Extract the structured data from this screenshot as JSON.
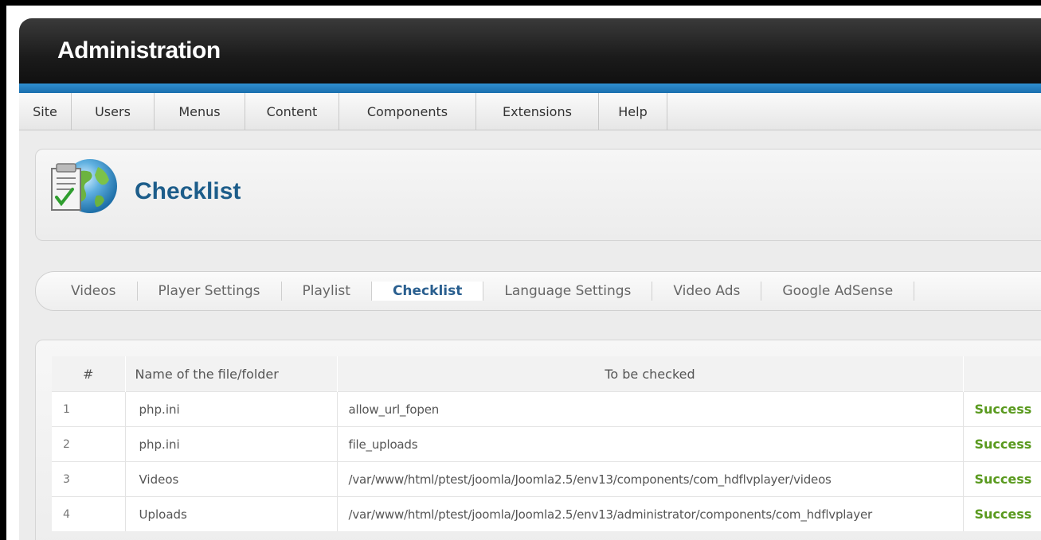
{
  "header": {
    "title": "Administration"
  },
  "menu": {
    "items": [
      {
        "label": "Site",
        "w": 66
      },
      {
        "label": "Users",
        "w": 104
      },
      {
        "label": "Menus",
        "w": 114
      },
      {
        "label": "Content",
        "w": 118
      },
      {
        "label": "Components",
        "w": 172
      },
      {
        "label": "Extensions",
        "w": 154
      },
      {
        "label": "Help",
        "w": 86
      }
    ]
  },
  "page": {
    "title": "Checklist",
    "icon": "checklist-globe-icon"
  },
  "tabs": {
    "items": [
      "Videos",
      "Player Settings",
      "Playlist",
      "Checklist",
      "Language Settings",
      "Video Ads",
      "Google AdSense"
    ],
    "active": "Checklist"
  },
  "table": {
    "headers": {
      "num": "#",
      "name": "Name of the file/folder",
      "check": "To be checked",
      "status": ""
    },
    "rows": [
      {
        "num": "1",
        "name": "php.ini",
        "check": "allow_url_fopen",
        "status": "Success"
      },
      {
        "num": "2",
        "name": "php.ini",
        "check": "file_uploads",
        "status": "Success"
      },
      {
        "num": "3",
        "name": "Videos",
        "check": "/var/www/html/ptest/joomla/Joomla2.5/env13/components/com_hdflvplayer/videos",
        "status": "Success"
      },
      {
        "num": "4",
        "name": "Uploads",
        "check": "/var/www/html/ptest/joomla/Joomla2.5/env13/administrator/components/com_hdflvplayer",
        "status": "Success"
      }
    ]
  },
  "colors": {
    "header_bg": "#1b1b1b",
    "accent_blue": "#1a6fae",
    "title_blue": "#1d5d8a",
    "success_green": "#5a9a1f"
  }
}
